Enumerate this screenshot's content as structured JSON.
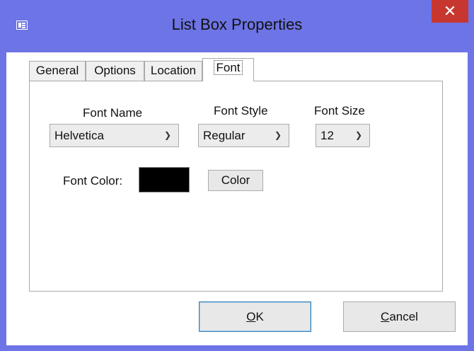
{
  "window": {
    "title": "List Box Properties",
    "close_glyph": "✕",
    "app_icon": "dialog-icon",
    "frame_color": "#6d74e6",
    "close_color": "#c7372f"
  },
  "tabs": [
    {
      "label": "General",
      "active": false
    },
    {
      "label": "Options",
      "active": false
    },
    {
      "label": "Location",
      "active": false
    },
    {
      "label": "Font",
      "active": true
    }
  ],
  "font": {
    "name_label": "Font Name",
    "name_value": "Helvetica",
    "style_label": "Font Style",
    "style_value": "Regular",
    "size_label": "Font Size",
    "size_value": "12",
    "color_label": "Font Color:",
    "color_value": "#000000",
    "color_button": "Color"
  },
  "buttons": {
    "ok_mnemonic": "O",
    "ok_rest": "K",
    "cancel_mnemonic": "C",
    "cancel_rest": "ancel"
  }
}
